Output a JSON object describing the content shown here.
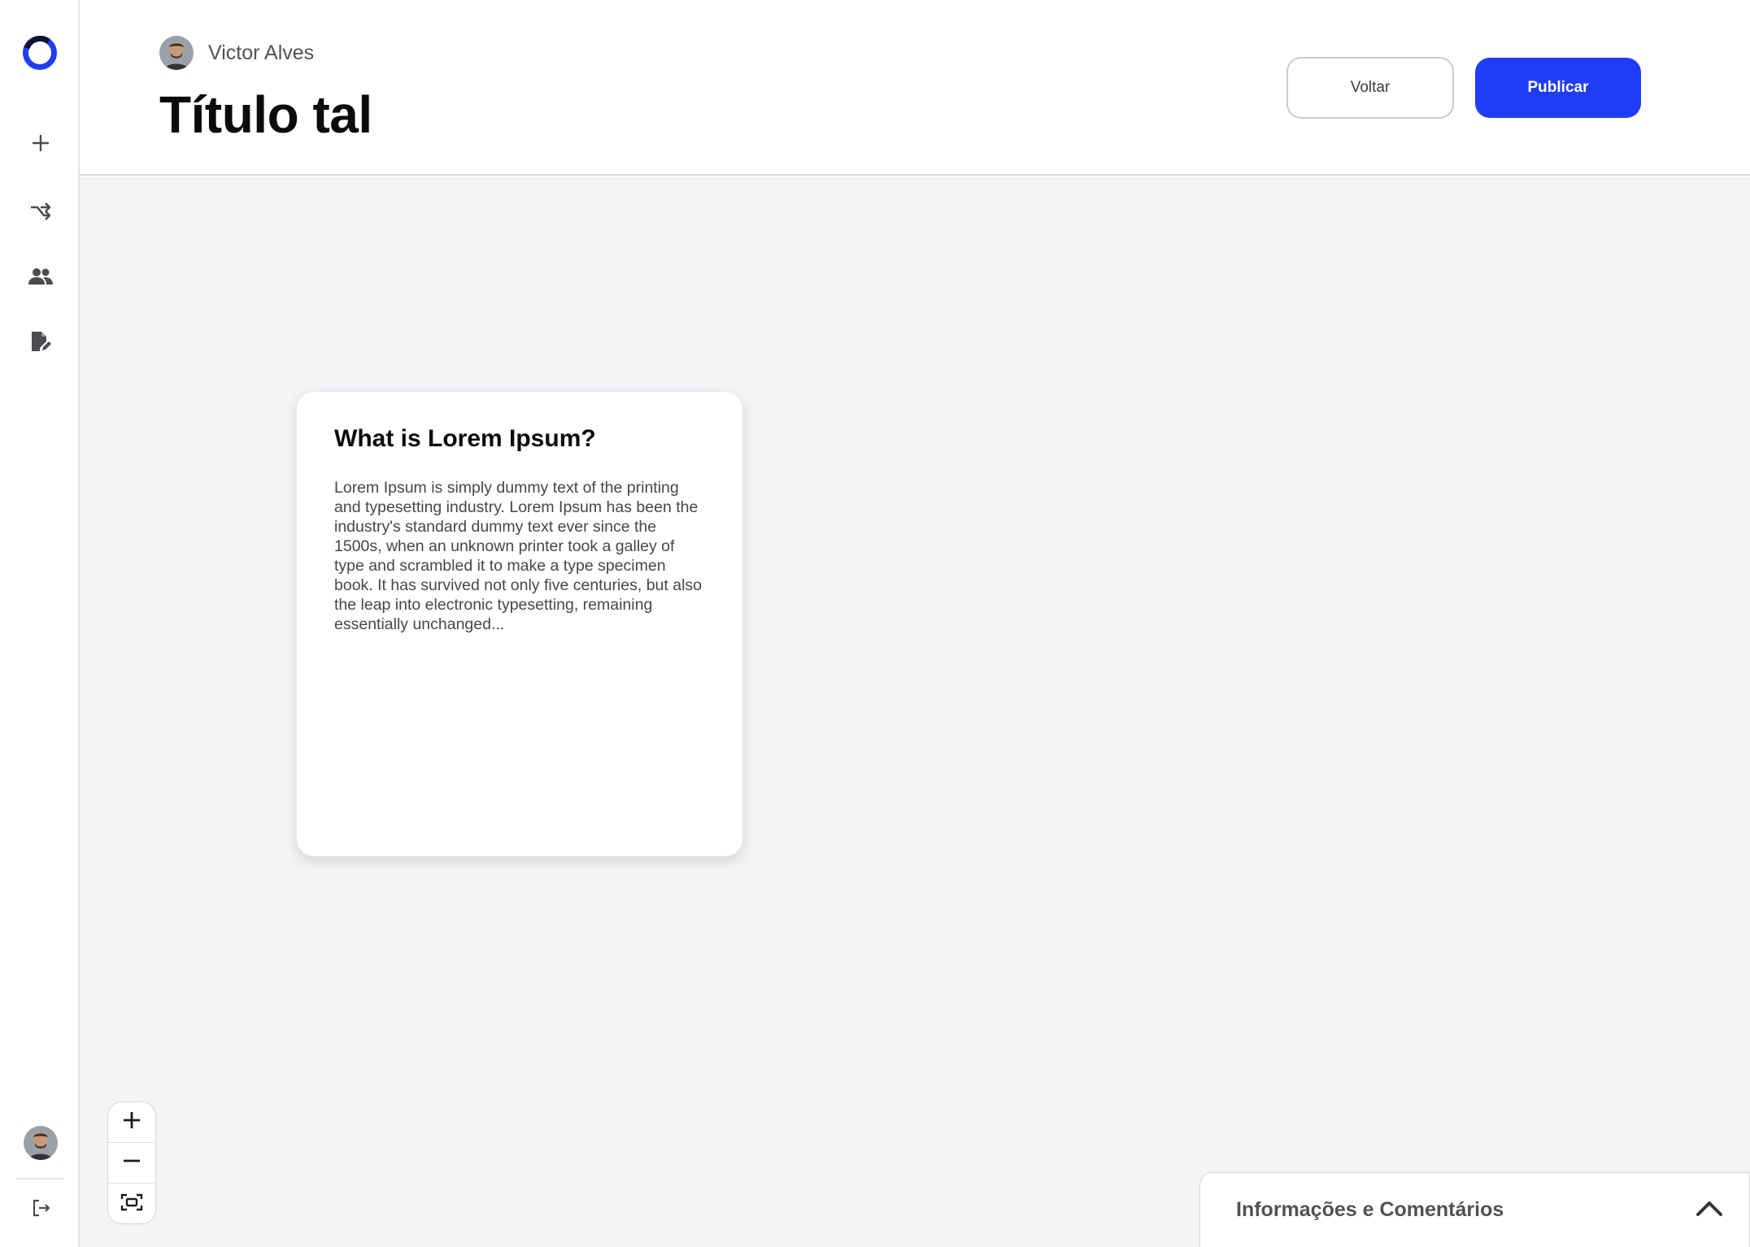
{
  "sidebar": {
    "logo": "app-logo",
    "items": [
      {
        "name": "new",
        "icon": "plus-icon"
      },
      {
        "name": "flows",
        "icon": "shuffle-arrow-icon"
      },
      {
        "name": "users",
        "icon": "people-icon"
      },
      {
        "name": "documents",
        "icon": "document-edit-icon"
      }
    ],
    "logout_icon": "logout-icon"
  },
  "header": {
    "author": "Victor Alves",
    "title": "Título tal",
    "back_label": "Voltar",
    "publish_label": "Publicar"
  },
  "card": {
    "title": "What is Lorem Ipsum?",
    "body": "Lorem Ipsum is simply dummy text of the printing and typesetting industry. Lorem Ipsum has been the industry's standard dummy text ever since the 1500s, when an unknown printer took a galley of type and scrambled it to make a type specimen book. It has survived not only five centuries, but also the leap into electronic typesetting, remaining essentially unchanged..."
  },
  "zoom": {
    "in_icon": "zoom-in-icon",
    "out_icon": "zoom-out-icon",
    "fit_icon": "fit-screen-icon"
  },
  "info_panel": {
    "label": "Informações e Comentários",
    "toggle_icon": "chevron-up-icon"
  },
  "colors": {
    "accent": "#1f3df5",
    "canvas_bg": "#f3f4f6",
    "text_dark": "#0b0b0c",
    "text_muted": "#505256"
  }
}
